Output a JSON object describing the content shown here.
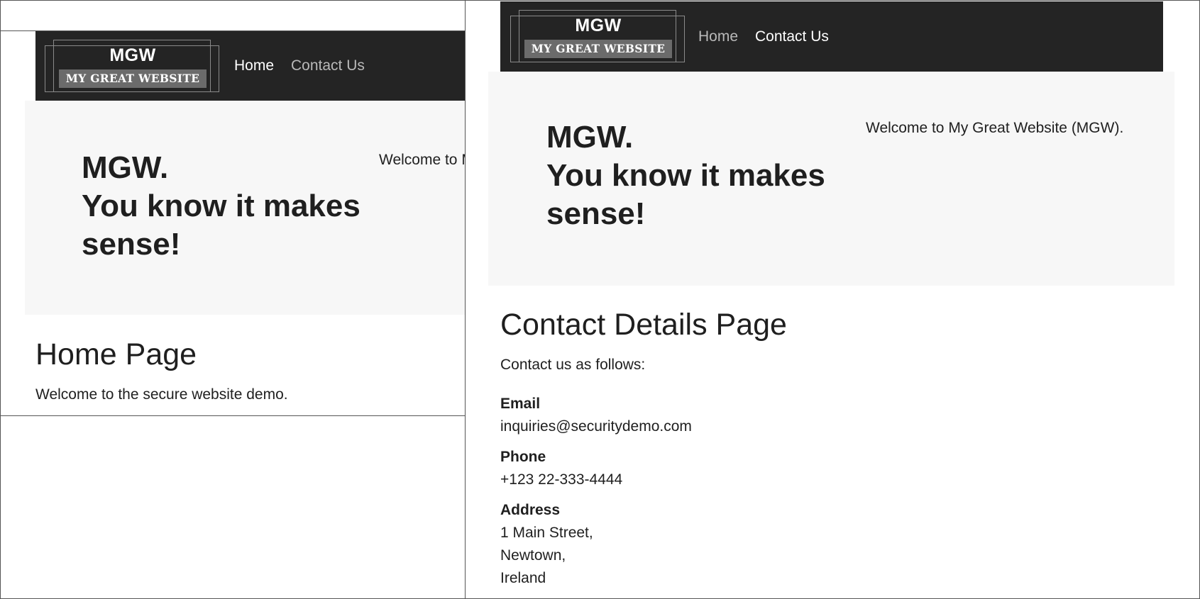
{
  "home_screen": {
    "nav": {
      "logo_title": "MGW",
      "logo_tagline": "MY GREAT WEBSITE",
      "links": [
        {
          "label": "Home",
          "active": true
        },
        {
          "label": "Contact Us",
          "active": false
        }
      ]
    },
    "hero": {
      "title_line1": "MGW.",
      "title_line2": "You know it makes",
      "title_line3": "sense!",
      "welcome": "Welcome to My Great Website (MGW)."
    },
    "page": {
      "heading": "Home Page",
      "text": "Welcome to the secure website demo."
    }
  },
  "contact_screen": {
    "nav": {
      "logo_title": "MGW",
      "logo_tagline": "MY GREAT WEBSITE",
      "links": [
        {
          "label": "Home",
          "active": false
        },
        {
          "label": "Contact Us",
          "active": true
        }
      ]
    },
    "hero": {
      "title_line1": "MGW.",
      "title_line2": "You know it makes",
      "title_line3": "sense!",
      "welcome": "Welcome to My Great Website (MGW)."
    },
    "page": {
      "heading": "Contact Details Page",
      "intro": "Contact us as follows:",
      "email_label": "Email",
      "email": "inquiries@securitydemo.com",
      "phone_label": "Phone",
      "phone": "+123 22-333-4444",
      "address_label": "Address",
      "address_lines": [
        "1 Main Street,",
        "Newtown,",
        "Ireland"
      ]
    }
  },
  "colors": {
    "navbar_bg": "#242424",
    "hero_bg": "#f7f7f7",
    "nav_active": "#ffffff",
    "nav_muted": "#b9b9b9",
    "logo_tag_bg": "#6b6b6b"
  }
}
